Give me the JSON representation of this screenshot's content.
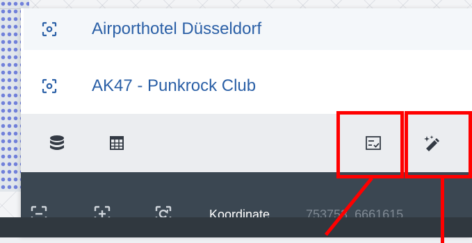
{
  "results": [
    {
      "label": "Airporthotel Düsseldorf",
      "icon": "focus-target-icon"
    },
    {
      "label": "AK47 - Punkrock Club",
      "icon": "focus-target-icon"
    }
  ],
  "toolbar": {
    "left_icons": [
      "database-icon",
      "calculator-icon"
    ],
    "right_icons": [
      "checklist-icon",
      "edit-wand-icon"
    ]
  },
  "statusbar": {
    "buttons": [
      "zoom-extent-icon",
      "zoom-in-icon",
      "refresh-icon"
    ],
    "coord_label": "Koordinate",
    "coord_value": "753753, 6661615"
  },
  "colors": {
    "accent_link": "#2a5fa6",
    "statusbar_bg": "#3b4752",
    "annotation": "#ff0000"
  }
}
